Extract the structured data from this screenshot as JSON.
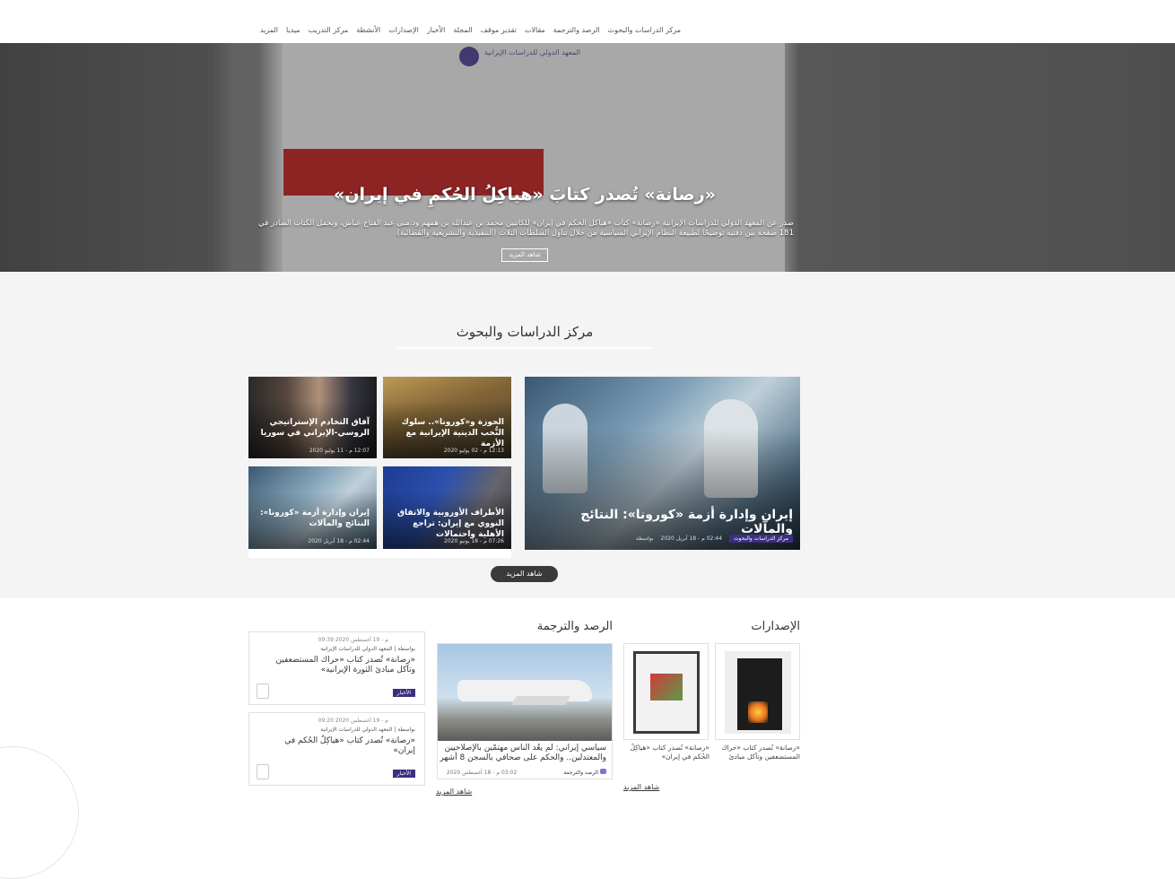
{
  "nav": {
    "items": [
      "مركز الدراسات والبحوث",
      "الرصد والترجمة",
      "مقالات",
      "تقدير موقف",
      "المجلة",
      "الأخبار",
      "الإصدارات",
      "الأنشطة",
      "مركز التدريب",
      "ميديا",
      "المزيد"
    ]
  },
  "hero": {
    "title": "«رصانة» تُصدر كتابَ «هياكِلُ الحُكمِ في إيران»",
    "description": "صدر عن المعهد الدولي للدراسات الإيرانية «رصانة» كتاب «هياكل الحكم في إيران» للكاتبين محمد بن عبدالله بن همهم ود.منى عبد الفتاح عباس، ويحمل الكتاب الصادر في 181 صفحة بين دفتيه توضيحًا لطبيعة النظام الإيراني السياسية من خلال تناول السلطات الثلاث (التنفيذية والتشريعية والقضائية).",
    "button": "شاهد المزيد",
    "logo_text": "المعهد الدولي للدراسات الإيرانية"
  },
  "studies": {
    "title": "مركز الدراسات والبحوث",
    "main": {
      "title": "إيران وإدارة أزمة «كورونا»: النتائج والمآلات",
      "badge": "مركز الدراسات والبحوث",
      "date": "02:44 م - 18 أبريل 2020",
      "by": "بواسطة"
    },
    "cards": [
      {
        "title": "الحوزة و«كورونا».. سلوك النُّخب الدينية الإيرانية مع الأزمة",
        "date": "12:13 م - 02 يوليو 2020"
      },
      {
        "title": "آفاق التخادم الإستراتيجي الروسي-الإيراني في سوريا",
        "date": "12:07 م - 11 يوليو 2020"
      },
      {
        "title": "الأطراف الأوروبية والاتفاق النووي مع إيران: تراجع الأهلية واحتمالات",
        "date": "07:26 م - 18 يونيو 2020"
      },
      {
        "title": "إيران وإدارة أزمة «كورونا»: النتائج والمآلات",
        "date": "02:44 م - 18 أبريل 2020"
      }
    ],
    "more": "شاهد المزيد"
  },
  "publications": {
    "title": "الإصدارات",
    "items": [
      {
        "caption": "«رصانة» تُصدر كتاب «حراك المستضعفين وتآكل مبادئ"
      },
      {
        "caption": "«رصانة» تُصدر كتاب «هياكِلُ الحُكم في إيران»"
      }
    ],
    "more": "شاهد المزيد"
  },
  "monitoring": {
    "title": "الرصد والترجمة",
    "item": {
      "title": "سياسي إيراني: لم يعُد الناس مهتمّين بالإصلاحيين والمعتدلين.. والحكم على صحافي بالسجن 8 أشهر",
      "date": "03:02 م - 18 أغسطس 2020",
      "category": "الرصد والترجمة"
    },
    "more": "شاهد المزيد"
  },
  "news": {
    "items": [
      {
        "date": "09:39 م - 19 أغسطس 2020",
        "by": "بواسطة | المعهد الدولي للدراسات الإيرانية",
        "title": "«رصانة» تُصدر كتاب «حراك المستضعفين وتآكل مبادئ الثورة الإيرانية»",
        "badge": "الأخبار"
      },
      {
        "date": "09:20 م - 19 أغسطس 2020",
        "by": "بواسطة | المعهد الدولي للدراسات الإيرانية",
        "title": "«رصانة» تُصدر كتاب «هياكِلُ الحُكم في إيران»",
        "badge": "الأخبار"
      }
    ]
  }
}
